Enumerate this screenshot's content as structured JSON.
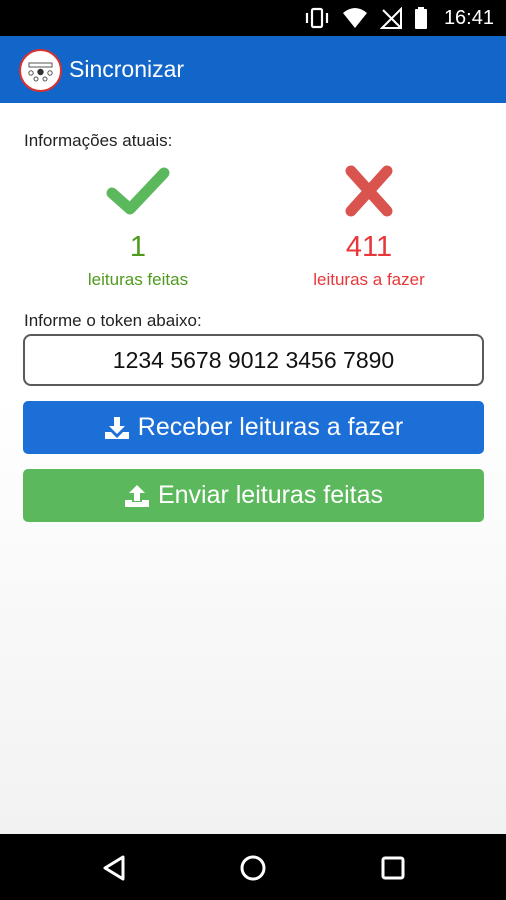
{
  "status_bar": {
    "time": "16:41",
    "icons": [
      "vibrate-icon",
      "wifi-icon",
      "no-sim-icon",
      "battery-icon"
    ]
  },
  "app_bar": {
    "title": "Sincronizar",
    "logo": "meter-logo"
  },
  "info": {
    "label": "Informações atuais:"
  },
  "stats": {
    "done": {
      "count": "1",
      "caption": "leituras feitas",
      "icon": "checkmark-icon",
      "color": "#4f9a1c"
    },
    "todo": {
      "count": "411",
      "caption": "leituras a fazer",
      "icon": "cross-icon",
      "color": "#e8373a"
    }
  },
  "token": {
    "label": "Informe o token abaixo:",
    "value": "1234 5678 9012 3456 7890"
  },
  "buttons": {
    "receive": {
      "label": "Receber leituras a fazer",
      "icon": "download-icon",
      "color": "#1b6fd6"
    },
    "send": {
      "label": "Enviar leituras feitas",
      "icon": "upload-icon",
      "color": "#5cb85c"
    }
  },
  "nav": {
    "back": "back-icon",
    "home": "home-icon",
    "recent": "recent-apps-icon"
  }
}
